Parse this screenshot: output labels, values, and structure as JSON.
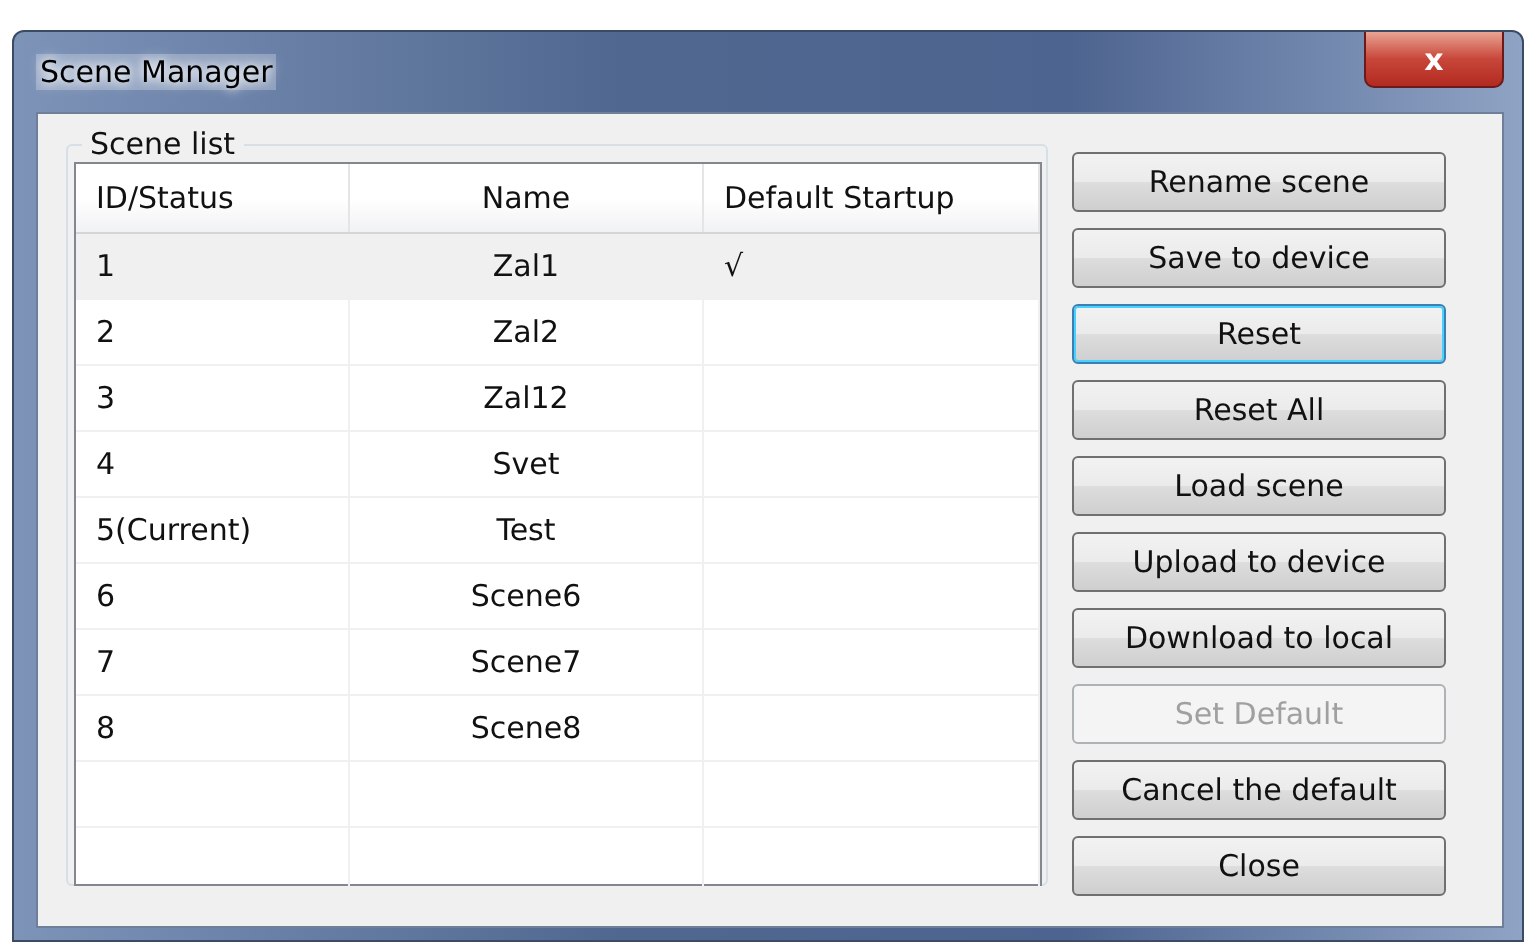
{
  "window": {
    "title": "Scene Manager",
    "close": "x"
  },
  "scene_list": {
    "label": "Scene list",
    "columns": [
      "ID/Status",
      "Name",
      "Default Startup"
    ],
    "rows": [
      {
        "id": "1",
        "name": "Zal1",
        "default": "√",
        "selected": true
      },
      {
        "id": "2",
        "name": "Zal2",
        "default": "",
        "selected": false
      },
      {
        "id": "3",
        "name": "Zal12",
        "default": "",
        "selected": false
      },
      {
        "id": "4",
        "name": "Svet",
        "default": "",
        "selected": false
      },
      {
        "id": "5(Current)",
        "name": "Test",
        "default": "",
        "selected": false
      },
      {
        "id": "6",
        "name": "Scene6",
        "default": "",
        "selected": false
      },
      {
        "id": "7",
        "name": "Scene7",
        "default": "",
        "selected": false
      },
      {
        "id": "8",
        "name": "Scene8",
        "default": "",
        "selected": false
      }
    ]
  },
  "buttons": [
    {
      "label": "Rename scene",
      "focused": false,
      "disabled": false
    },
    {
      "label": "Save to device",
      "focused": false,
      "disabled": false
    },
    {
      "label": "Reset",
      "focused": true,
      "disabled": false
    },
    {
      "label": "Reset All",
      "focused": false,
      "disabled": false
    },
    {
      "label": "Load scene",
      "focused": false,
      "disabled": false
    },
    {
      "label": "Upload to device",
      "focused": false,
      "disabled": false
    },
    {
      "label": "Download to local",
      "focused": false,
      "disabled": false
    },
    {
      "label": "Set Default",
      "focused": false,
      "disabled": true
    },
    {
      "label": "Cancel the default",
      "focused": false,
      "disabled": false
    },
    {
      "label": "Close",
      "focused": false,
      "disabled": false
    }
  ]
}
